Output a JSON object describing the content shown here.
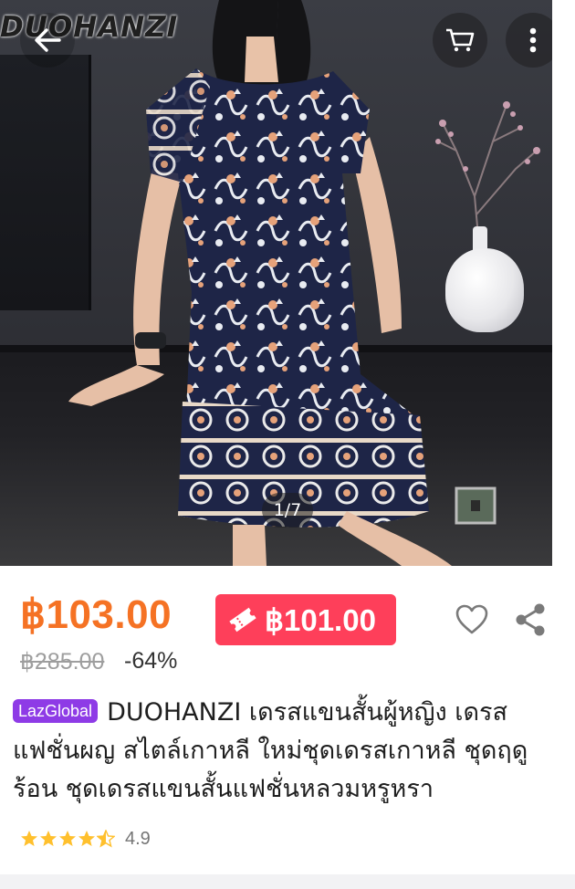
{
  "header": {
    "brand_logo_text": "DUOHANZI",
    "back_icon": "arrow-left-icon",
    "cart_icon": "cart-icon",
    "more_icon": "more-vertical-icon"
  },
  "gallery": {
    "counter": "1/7"
  },
  "price": {
    "current": "฿103.00",
    "voucher_price": "฿101.00",
    "voucher_icon": "voucher-ticket-icon",
    "original": "฿285.00",
    "discount": "-64%"
  },
  "actions": {
    "wishlist_icon": "heart-outline-icon",
    "share_icon": "share-icon"
  },
  "product": {
    "badge": "LazGlobal",
    "title": "DUOHANZI เดรสแขนสั้นผู้หญิง เดรสแฟชั่นผญ สไตล์เกาหลี ใหม่ชุดเดรสเกาหลี ชุดฤดูร้อน ชุดเดรสแขนสั้นแฟชั่นหลวมหรูหรา"
  },
  "rating": {
    "value": "4.9",
    "stars": 4.5
  },
  "colors": {
    "price_orange": "#f57224",
    "voucher_red": "#fe3f5a",
    "badge_purple": "#8e3be6",
    "star_yellow": "#ffc02d"
  }
}
